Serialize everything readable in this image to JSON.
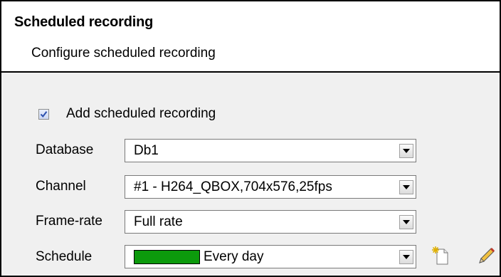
{
  "header": {
    "title": "Scheduled recording",
    "subtitle": "Configure scheduled recording"
  },
  "add_scheduled": {
    "label": "Add scheduled recording",
    "checked": true
  },
  "fields": {
    "database": {
      "label": "Database",
      "value": "Db1"
    },
    "channel": {
      "label": "Channel",
      "value": "#1 - H264_QBOX,704x576,25fps"
    },
    "frame_rate": {
      "label": "Frame-rate",
      "value": "Full rate"
    },
    "schedule": {
      "label": "Schedule",
      "value": "Every day",
      "swatch_color": "#0c9a0c"
    }
  },
  "icons": {
    "new_schedule": "new-document-icon",
    "edit_schedule": "pencil-edit-icon"
  },
  "colors": {
    "panel_background": "#f0f0f0",
    "header_background": "#ffffff",
    "checkbox_check": "#2b4fae"
  }
}
